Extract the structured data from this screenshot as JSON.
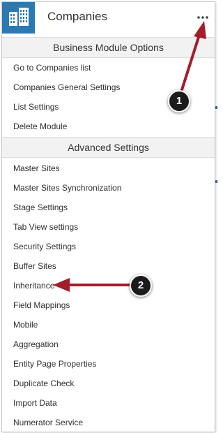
{
  "header": {
    "title": "Companies",
    "app_icon": "building-icon",
    "more_icon": "more-dots-icon"
  },
  "business_module_options": {
    "title": "Business Module Options",
    "items": [
      "Go to Companies list",
      "Companies General Settings",
      "List Settings",
      "Delete Module"
    ]
  },
  "advanced_settings": {
    "title": "Advanced Settings",
    "items": [
      "Master Sites",
      "Master Sites Synchronization",
      "Stage Settings",
      "Tab View settings",
      "Security Settings",
      "Buffer Sites",
      "Inheritance",
      "Field Mappings",
      "Mobile",
      "Aggregation",
      "Entity Page Properties",
      "Duplicate Check",
      "Import Data",
      "Numerator Service"
    ]
  },
  "annotations": {
    "marker_1": "1",
    "marker_2": "2"
  },
  "colors": {
    "accent": "#2b79b3",
    "annotation_arrow": "#a31d2a",
    "marker_fill": "#1b1b1b"
  }
}
